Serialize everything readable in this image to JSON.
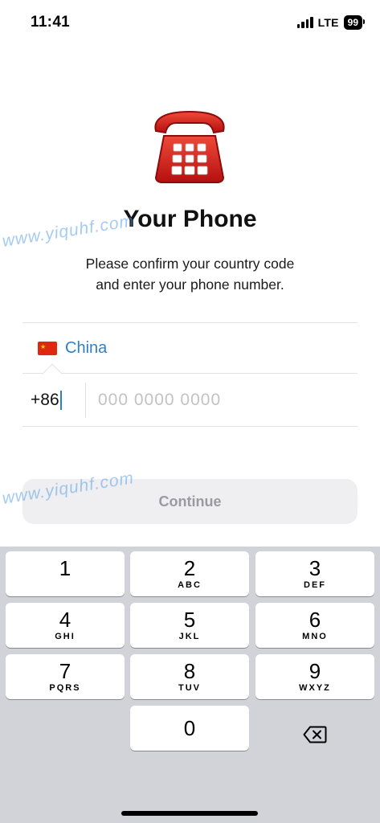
{
  "status_bar": {
    "time": "11:41",
    "network": "LTE",
    "battery": "99"
  },
  "header": {
    "icon": "telephone-icon",
    "title": "Your Phone",
    "subtitle_line1": "Please confirm your country code",
    "subtitle_line2": "and enter your phone number."
  },
  "country": {
    "flag": "china-flag-icon",
    "name": "China"
  },
  "phone_input": {
    "country_code": "+86",
    "placeholder": "000 0000 0000",
    "value": ""
  },
  "continue_label": "Continue",
  "keypad": {
    "keys": [
      {
        "digit": "1",
        "letters": ""
      },
      {
        "digit": "2",
        "letters": "ABC"
      },
      {
        "digit": "3",
        "letters": "DEF"
      },
      {
        "digit": "4",
        "letters": "GHI"
      },
      {
        "digit": "5",
        "letters": "JKL"
      },
      {
        "digit": "6",
        "letters": "MNO"
      },
      {
        "digit": "7",
        "letters": "PQRS"
      },
      {
        "digit": "8",
        "letters": "TUV"
      },
      {
        "digit": "9",
        "letters": "WXYZ"
      },
      {
        "digit": "0",
        "letters": ""
      }
    ],
    "backspace_icon": "backspace-icon"
  },
  "watermark": "www.yiquhf.com",
  "colors": {
    "accent": "#2f7fc8",
    "button_bg": "#efeff1",
    "button_text": "#9a9aa0",
    "keyboard_bg": "#d1d3d9",
    "phone_red": "#d91a1a"
  }
}
